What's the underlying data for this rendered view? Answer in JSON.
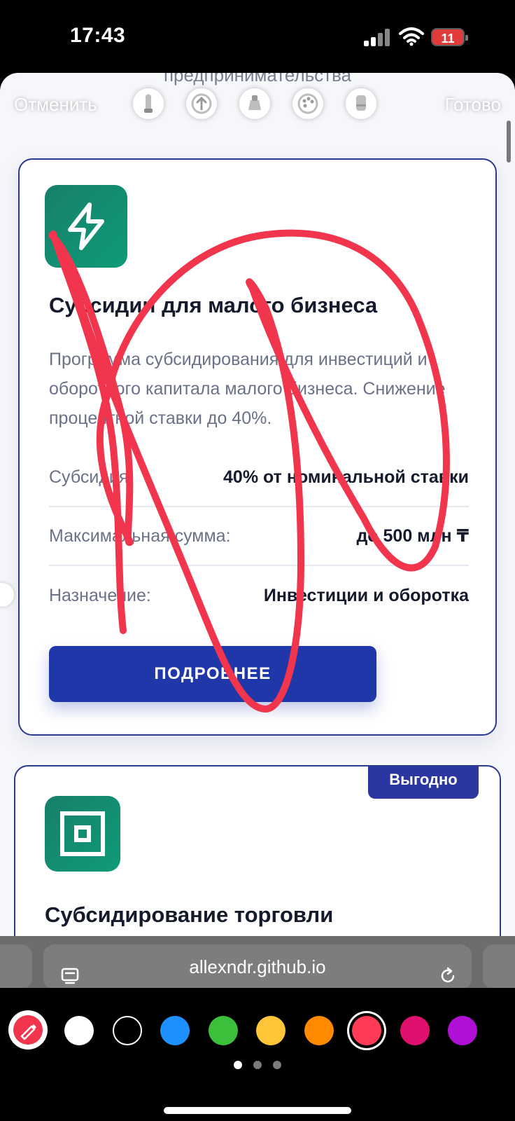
{
  "status": {
    "time": "17:43",
    "battery": "11"
  },
  "page": {
    "top_partial_title": "предпринимательства"
  },
  "markup": {
    "cancel_label": "Отменить",
    "done_label": "Готово",
    "tools": [
      "pen-tool-icon",
      "arrow-up-icon",
      "highlighter-icon",
      "palette-icon",
      "eraser-icon"
    ]
  },
  "card1": {
    "icon": "lightning-icon",
    "title": "Субсидии для малого бизнеса",
    "description": "Программа субсидирования для инвестиций и оборотного капитала малого бизнеса. Снижение процентной ставки до 40%.",
    "details": [
      {
        "label": "Субсидия:",
        "value": "40% от номинальной ставки"
      },
      {
        "label": "Максимальная сумма:",
        "value": "до 500 млн ₸"
      },
      {
        "label": "Назначение:",
        "value": "Инвестиции и оборотка"
      }
    ],
    "button_label": "ПОДРОБНЕЕ"
  },
  "card2": {
    "badge": "Выгодно",
    "icon": "square-target-icon",
    "title": "Субсидирование торговли"
  },
  "browser": {
    "url": "allexndr.github.io"
  },
  "palette": {
    "colors": [
      "#ffffff",
      "#000000",
      "#1e90ff",
      "#3cc03c",
      "#ffc63a",
      "#ff8a00",
      "#ff3b55",
      "#e0106f",
      "#b010d6"
    ],
    "selected_color": "#ff3b55",
    "scribble_color": "#f0354d"
  }
}
